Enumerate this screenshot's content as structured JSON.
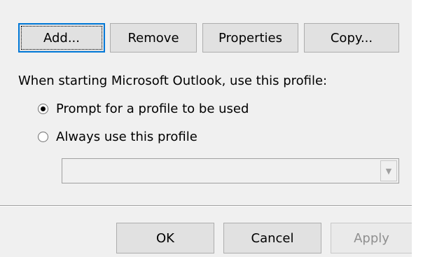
{
  "profile_buttons": {
    "add": "Add...",
    "remove": "Remove",
    "properties": "Properties",
    "copy": "Copy..."
  },
  "startup": {
    "label": "When starting Microsoft Outlook, use this profile:",
    "options": [
      {
        "label": "Prompt for a profile to be used",
        "selected": true
      },
      {
        "label": "Always use this profile",
        "selected": false
      }
    ],
    "profile_select": {
      "value": "",
      "enabled": false
    }
  },
  "dialog_buttons": {
    "ok": "OK",
    "cancel": "Cancel",
    "apply": "Apply"
  },
  "icons": {
    "dropdown": "chevron-down-icon"
  },
  "colors": {
    "default_button_border": "#0078d7",
    "window_background": "#f0f0f0"
  }
}
